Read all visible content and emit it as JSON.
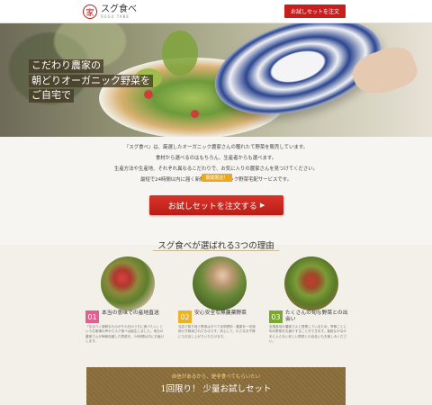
{
  "header": {
    "logo_mark": "家",
    "logo_name": "スグ食べ",
    "logo_sub": "SUGU TABE",
    "cta_label": "お試しセットを注文"
  },
  "hero": {
    "lines": [
      "こだわり農家の",
      "朝どりオーガニック野菜を",
      "ご自宅で"
    ]
  },
  "intro": {
    "paragraphs": [
      "『スグ食べ』は、厳選したオーガニック農家さんの穫れたて野菜を販売しています。",
      "食材から選べるのはもちろん、生産者からも選べます。",
      "生産方法や生産地、それぞれ異なるこだわりで、お気に入りの農家さんを見つけてください。",
      "最短で24時間以内に届く新鮮なオーガニック野菜宅配サービスです。"
    ],
    "badge": "期間限定！",
    "cta_label": "お試しセットを注文する"
  },
  "reasons": {
    "title": "スグ食べが選ばれる3つの理由",
    "items": [
      {
        "num": "01",
        "head": "本当の意味での産地直送",
        "body": "「なるべく新鮮なものがその日のうちに食べたい」というお客様の声からスグ食べは誕生しました。地元の農家さんが毎朝収穫した野菜を、24時間以内にお届けします。"
      },
      {
        "num": "02",
        "head": "安心安全な無農薬野菜",
        "body": "当店で取り扱う野菜はすべて化学肥料・農薬を一切使用せず栽培されたものです。安心して、小さなお子様にもお召し上がりいただけます。"
      },
      {
        "num": "03",
        "head": "たくさんの旬な野菜との出会い",
        "body": "全国各地の農家さんと提携しているため、季節ごとに旬の野菜をお届けすることができます。普段なかなか手に入らない珍しい野菜との出会いもお楽しみください。"
      }
    ]
  },
  "offer": {
    "sub": "自信があるから、是非食べてもらいたい",
    "title": "1回限り！ 少量お試しセット"
  },
  "colors": {
    "accent_red": "#c81e1e",
    "badge_yellow": "#e9a826",
    "num1": "#e35f92",
    "num2": "#ecb227",
    "num3": "#7aa82a",
    "offer_brown": "#8a6d3b"
  }
}
